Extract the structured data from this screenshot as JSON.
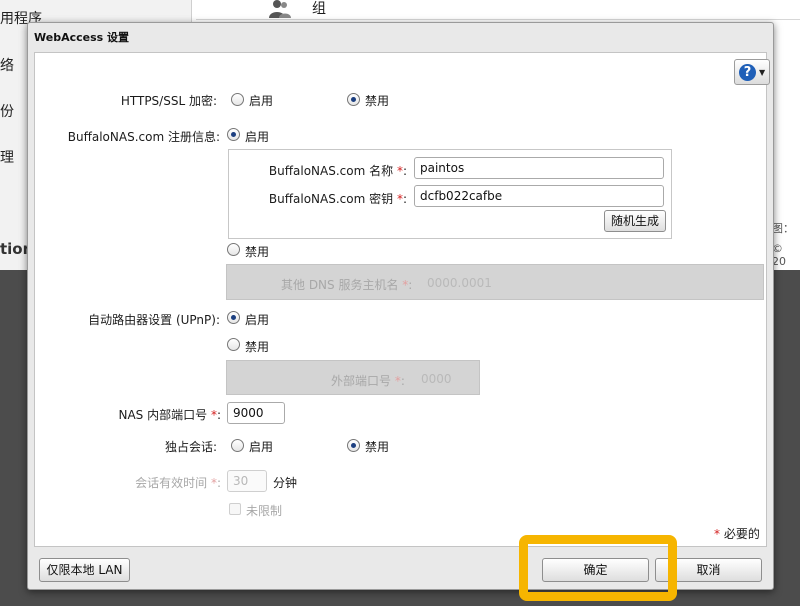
{
  "background": {
    "sidebar_items": [
      "用程序",
      "络",
      "份",
      "理"
    ],
    "group_label": "组",
    "logo_fragment": "tion",
    "right_text_1": "图：",
    "right_text_2": "© 20"
  },
  "dialog": {
    "title": "WebAccess 设置",
    "help_icon": "question-icon"
  },
  "form": {
    "https": {
      "label": "HTTPS/SSL 加密:",
      "enable": "启用",
      "disable": "禁用",
      "selected": "disable"
    },
    "buffalonas": {
      "label": "BuffaloNAS.com 注册信息:",
      "enable": "启用",
      "disable": "禁用",
      "selected": "enable",
      "name_label": "BuffaloNAS.com 名称",
      "name_value": "paintos",
      "key_label": "BuffaloNAS.com 密钥",
      "key_value": "dcfb022cafbe",
      "random_button": "随机生成",
      "dns_label": "其他 DNS 服务主机名",
      "dns_value": "0000.0001"
    },
    "upnp": {
      "label": "自动路由器设置 (UPnP):",
      "enable": "启用",
      "disable": "禁用",
      "selected": "enable",
      "external_port_label": "外部端口号",
      "external_port_value": "0000"
    },
    "nas_port": {
      "label": "NAS 内部端口号",
      "value": "9000"
    },
    "exclusive_session": {
      "label": "独占会话:",
      "enable": "启用",
      "disable": "禁用",
      "selected": "disable"
    },
    "session_timeout": {
      "label": "会话有效时间",
      "value": "30",
      "unit": "分钟",
      "unlimited": "未限制"
    },
    "required_asterisk": "*",
    "colon": ":",
    "required_note": "必要的"
  },
  "footer": {
    "local_lan_button": "仅限本地 LAN",
    "ok_button": "确定",
    "cancel_button": "取消"
  },
  "colors": {
    "highlight": "#f6b500",
    "radio_selected": "#1c3f80",
    "required": "#d42020"
  }
}
